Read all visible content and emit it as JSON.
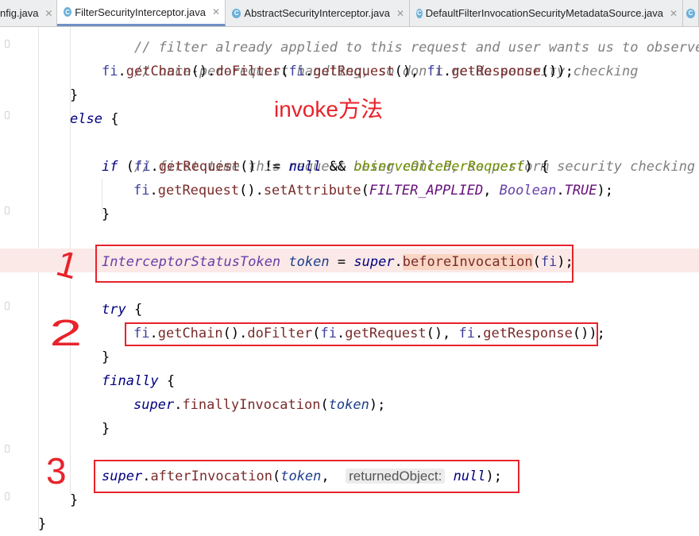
{
  "tabs": [
    {
      "label": "nfig.java",
      "icon": "",
      "active": false
    },
    {
      "label": "FilterSecurityInterceptor.java",
      "icon": "class-icon",
      "active": true
    },
    {
      "label": "AbstractSecurityInterceptor.java",
      "icon": "class-icon",
      "active": false
    },
    {
      "label": "DefaultFilterInvocationSecurityMetadataSource.java",
      "icon": "class-icon",
      "active": false
    }
  ],
  "code": {
    "l1_comment_partial": "// filter already applied to this request and user wants us to observe",
    "l2_comment": "// once-per-request handling, so don't re-do security checking",
    "l3_fi": "fi",
    "l3_getChain": "getChain",
    "l3_doFilter": "doFilter",
    "l3_getRequest": "getRequest",
    "l3_getResponse": "getResponse",
    "l4_brace": "}",
    "l5_else": "else",
    "l5_brace": "{",
    "l6_comment": "// first time this request being called, so perform security checking",
    "l7_if": "if",
    "l7_fi": "fi",
    "l7_getRequest": "getRequest",
    "l7_ne": "!=",
    "l7_null": "null",
    "l7_and": "&&",
    "l7_observe": "observeOncePerRequest",
    "l7_brace": "{",
    "l8_fi": "fi",
    "l8_getRequest": "getRequest",
    "l8_setAttribute": "setAttribute",
    "l8_const": "FILTER_APPLIED",
    "l8_boolean": "Boolean",
    "l8_true": "TRUE",
    "l9_brace": "}",
    "l11_type": "InterceptorStatusToken",
    "l11_var": "token",
    "l11_eq": "=",
    "l11_super": "super",
    "l11_method": "beforeInvocation",
    "l11_arg": "fi",
    "l13_try": "try",
    "l13_brace": "{",
    "l14_fi": "fi",
    "l14_getChain": "getChain",
    "l14_doFilter": "doFilter",
    "l14_getRequest": "getRequest",
    "l14_getResponse": "getResponse",
    "l15_brace": "}",
    "l16_finally": "finally",
    "l16_brace": "{",
    "l17_super": "super",
    "l17_method": "finallyInvocation",
    "l17_arg": "token",
    "l18_brace": "}",
    "l20_super": "super",
    "l20_method": "afterInvocation",
    "l20_arg": "token",
    "l20_hint": "returnedObject:",
    "l20_null": "null",
    "l21_brace": "}",
    "l22_brace": "}"
  },
  "annotations": {
    "title": "invoke方法",
    "mark1": "1",
    "mark2": "2",
    "mark3": "3"
  }
}
